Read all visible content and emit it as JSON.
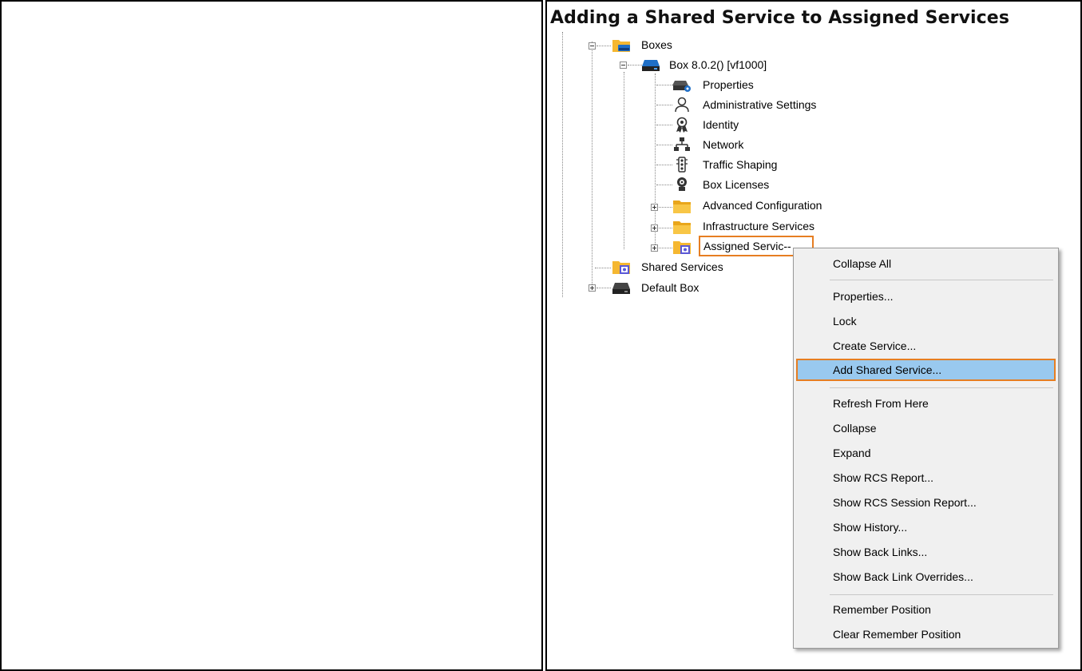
{
  "page": {
    "title": "Adding a Shared Service to Assigned Services"
  },
  "tree": {
    "boxes": "Boxes",
    "box": "Box 8.0.2() [vf1000]",
    "properties": "Properties",
    "admin_settings": "Administrative Settings",
    "identity": "Identity",
    "network": "Network",
    "traffic_shaping": "Traffic Shaping",
    "box_licenses": "Box Licenses",
    "advanced_configuration": "Advanced Configuration",
    "infrastructure_services": "Infrastructure Services",
    "assigned_services": "Assigned Servic--",
    "shared_services": "Shared Services",
    "default_box": "Default Box"
  },
  "context_menu": {
    "items": [
      "Collapse All",
      "Properties...",
      "Lock",
      "Create Service...",
      "Add Shared Service...",
      "Refresh From Here",
      "Collapse",
      "Expand",
      "Show RCS Report...",
      "Show RCS Session Report...",
      "Show History...",
      "Show Back Links...",
      "Show Back Link Overrides...",
      "Remember Position",
      "Clear Remember Position"
    ],
    "highlighted_index": 4
  },
  "colors": {
    "folder": "#f5b731",
    "box_blue": "#1f6fc7",
    "highlight": "#99c9ef",
    "callout": "#e67e22"
  },
  "icons": {
    "boxes": "folder-box-icon",
    "box": "box-server-icon",
    "properties": "server-gear-icon",
    "admin_settings": "user-outline-icon",
    "identity": "certificate-icon",
    "network": "network-tree-icon",
    "traffic_shaping": "traffic-light-icon",
    "box_licenses": "license-badge-icon",
    "folder": "folder-icon",
    "assigned_services": "folder-service-icon",
    "shared_services": "folder-service-icon",
    "default_box": "box-server-icon"
  }
}
